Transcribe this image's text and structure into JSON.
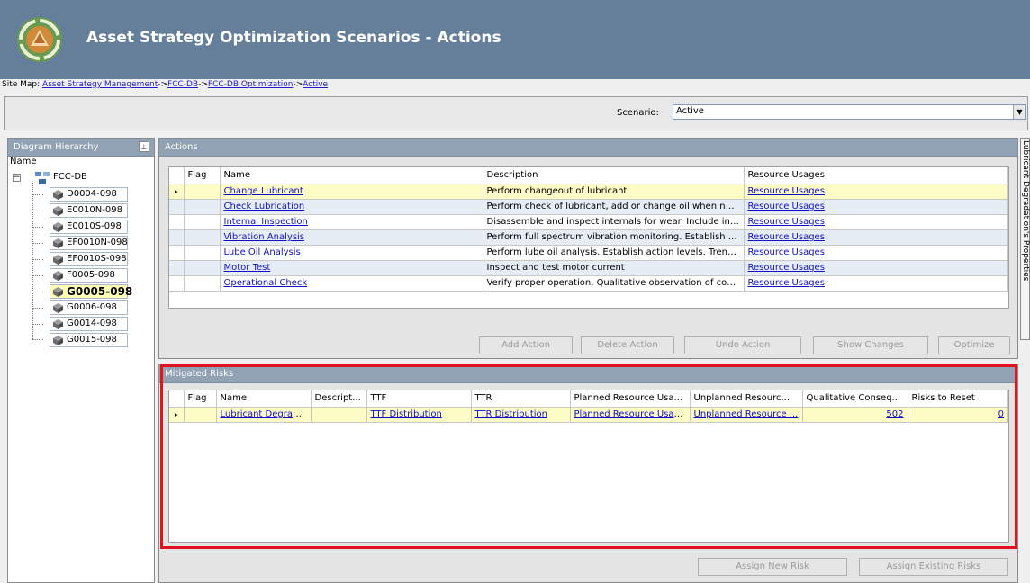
{
  "header": {
    "title": "Asset Strategy Optimization Scenarios  - Actions"
  },
  "sitemap": {
    "prefix": "Site Map:",
    "crumbs": [
      "Asset Strategy Management",
      "FCC-DB",
      "FCC-DB Optimization",
      "Active"
    ],
    "separator": "->"
  },
  "scenario": {
    "label": "Scenario:",
    "value": "Active"
  },
  "hierarchy": {
    "title": "Diagram Hierarchy",
    "column": "Name",
    "root": "FCC-DB",
    "items": [
      "D0004-098",
      "E0010N-098",
      "E0010S-098",
      "EF0010N-098",
      "EF0010S-098",
      "F0005-098",
      "G0005-098",
      "G0006-098",
      "G0014-098",
      "G0015-098"
    ],
    "selected": "G0005-098"
  },
  "actions": {
    "title": "Actions",
    "columns": [
      "Flag",
      "Name",
      "Description",
      "Resource Usages"
    ],
    "rows": [
      {
        "name": "Change Lubricant",
        "description": "Perform changeout of lubricant",
        "usage": "Resource Usages"
      },
      {
        "name": "Check Lubrication",
        "description": "Perform check of lubricant, add or change oil when needed",
        "usage": "Resource Usages"
      },
      {
        "name": "Internal Inspection",
        "description": "Disassemble and inspect internals for wear. Include inspecti...",
        "usage": "Resource Usages"
      },
      {
        "name": "Vibration Analysis",
        "description": "Perform full spectrum vibration monitoring. Establish baselin...",
        "usage": "Resource Usages"
      },
      {
        "name": "Lube Oil Analysis",
        "description": "Perform lube oil analysis. Establish action levels. Trend resul...",
        "usage": "Resource Usages"
      },
      {
        "name": "Motor Test",
        "description": "Inspect and test motor current",
        "usage": "Resource Usages"
      },
      {
        "name": "Operational Check",
        "description": "Verify proper operation.  Qualitative observation of conditio...",
        "usage": "Resource Usages"
      }
    ],
    "buttons": {
      "add": "Add Action",
      "delete": "Delete Action",
      "undo": "Undo Action",
      "show": "Show Changes",
      "optimize": "Optimize"
    }
  },
  "risks": {
    "title": "Mitigated Risks",
    "columns": [
      "Flag",
      "Name",
      "Descript...",
      "TTF",
      "TTR",
      "Planned Resource Usa...",
      "Unplanned Resourc...",
      "Qualitative Conseq...",
      "Risks to Reset"
    ],
    "rows": [
      {
        "name": "Lubricant Degradation",
        "description": "",
        "ttf": "TTF Distribution",
        "ttr": "TTR Distribution",
        "planned": "Planned Resource Usages",
        "unplanned": "Unplanned Resource ...",
        "consequence": "502",
        "reset": "0"
      }
    ],
    "buttons": {
      "assign_new": "Assign New Risk",
      "assign_existing": "Assign Existing Risks"
    }
  },
  "side_tab": {
    "label": "Lubricant Degradation's Properties"
  }
}
